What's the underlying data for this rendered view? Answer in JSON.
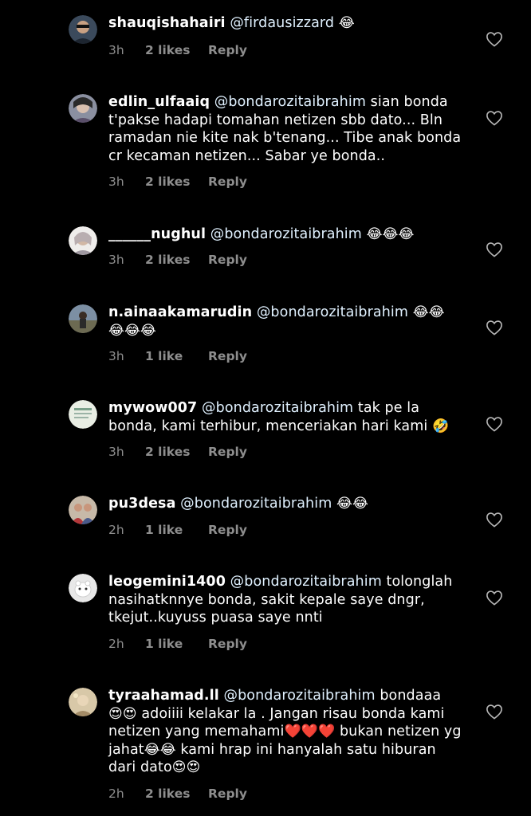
{
  "heart_icon": "heart-outline-icon",
  "reply_label": "Reply",
  "comments": [
    {
      "username": "shauqishahairi",
      "mention": "@firdausizzard",
      "text_lines": [],
      "emoji_inline": "😂",
      "time": "3h",
      "likes": "2 likes",
      "avatar_color": "#3b4a5c"
    },
    {
      "username": "edlin_ulfaaiq",
      "mention": "@bondarozitaibrahim",
      "text": "sian bonda t'pakse hadapi tomahan netizen sbb dato... Bln ramadan nie kite nak b'tenang... Tibe anak bonda cr kecaman netizen... Sabar ye bonda..",
      "time": "3h",
      "likes": "2 likes",
      "avatar_color": "#8a8fa0"
    },
    {
      "username": "______nughul",
      "mention": "@bondarozitaibrahim",
      "emoji_inline": "😂😂😂",
      "time": "3h",
      "likes": "2 likes",
      "avatar_color": "#d8d4d2"
    },
    {
      "username": "n.ainaakamarudin",
      "mention": "@bondarozitaibrahim",
      "emoji_inline": "😂😂",
      "emoji_line2": "😂😂😂",
      "time": "3h",
      "likes": "1 like",
      "avatar_color": "#6c6a52"
    },
    {
      "username": "mywow007",
      "mention": "@bondarozitaibrahim",
      "text": "tak pe la bonda, kami terhibur, menceriakan hari kami",
      "emoji_end": "🤣",
      "time": "3h",
      "likes": "2 likes",
      "avatar_color": "#e9eee4"
    },
    {
      "username": "pu3desa",
      "mention": "@bondarozitaibrahim",
      "emoji_inline": "😂😂",
      "time": "2h",
      "likes": "1 like",
      "avatar_color": "#7a3a35"
    },
    {
      "username": "leogemini1400",
      "mention": "@bondarozitaibrahim",
      "text": "tolonglah nasihatknnye bonda, sakit kepale saye dngr, tkejut..kuyuss puasa saye nnti",
      "time": "2h",
      "likes": "1 like",
      "avatar_color": "#e8e8e8"
    },
    {
      "username": "tyraahamad.ll",
      "mention": "@bondarozitaibrahim",
      "text_parts": [
        "bondaaa",
        "😍😍",
        "adoiiii kelakar la . Jangan risau bonda kami netizen yang memahami",
        "❤️❤️❤️",
        "bukan netizen yg jahat",
        "😂😂",
        "kami hrap ini hanyalah satu hiburan dari dato",
        "😍😍"
      ],
      "time": "2h",
      "likes": "2 likes",
      "avatar_color": "#b8a58a"
    }
  ]
}
